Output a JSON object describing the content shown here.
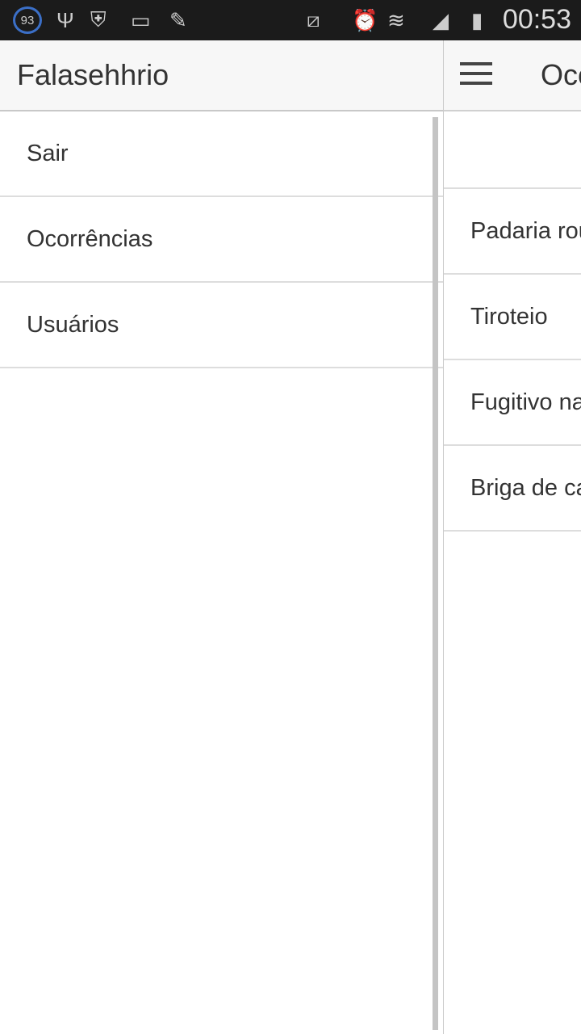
{
  "status_bar": {
    "notification_count": "93",
    "time": "00:53",
    "icons": [
      "usb-icon",
      "shield-mail-icon",
      "voicemail-icon",
      "pencil-icon",
      "mute-vibrate-icon",
      "alarm-icon",
      "wifi-icon",
      "signal-icon",
      "battery-charging-icon"
    ]
  },
  "drawer": {
    "title": "Falasehhrio",
    "items": [
      {
        "label": "Sair"
      },
      {
        "label": "Ocorrências"
      },
      {
        "label": "Usuários"
      }
    ]
  },
  "main": {
    "title": "Ocorrências",
    "items": [
      {
        "label": "Padaria roubada"
      },
      {
        "label": "Tiroteio"
      },
      {
        "label": "Fugitivo na rua"
      },
      {
        "label": "Briga de casal"
      }
    ]
  }
}
